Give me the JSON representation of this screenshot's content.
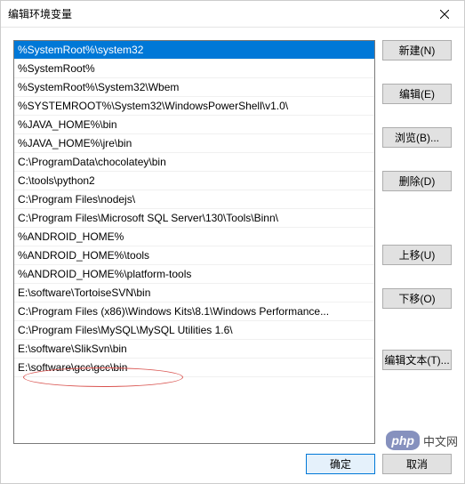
{
  "window": {
    "title": "编辑环境变量"
  },
  "list": {
    "items": [
      "%SystemRoot%\\system32",
      "%SystemRoot%",
      "%SystemRoot%\\System32\\Wbem",
      "%SYSTEMROOT%\\System32\\WindowsPowerShell\\v1.0\\",
      "%JAVA_HOME%\\bin",
      "%JAVA_HOME%\\jre\\bin",
      "C:\\ProgramData\\chocolatey\\bin",
      "C:\\tools\\python2",
      "C:\\Program Files\\nodejs\\",
      "C:\\Program Files\\Microsoft SQL Server\\130\\Tools\\Binn\\",
      "%ANDROID_HOME%",
      "%ANDROID_HOME%\\tools",
      "%ANDROID_HOME%\\platform-tools",
      "E:\\software\\TortoiseSVN\\bin",
      "C:\\Program Files (x86)\\Windows Kits\\8.1\\Windows Performance...",
      "C:\\Program Files\\MySQL\\MySQL Utilities 1.6\\",
      "E:\\software\\SlikSvn\\bin",
      "E:\\software\\gcc\\gcc\\bin"
    ],
    "selected_index": 0,
    "highlighted_index": 17
  },
  "buttons": {
    "new": "新建(N)",
    "edit": "编辑(E)",
    "browse": "浏览(B)...",
    "delete": "删除(D)",
    "move_up": "上移(U)",
    "move_down": "下移(O)",
    "edit_text": "编辑文本(T)...",
    "ok": "确定",
    "cancel": "取消"
  },
  "watermark": {
    "logo": "php",
    "text": "中文网"
  }
}
